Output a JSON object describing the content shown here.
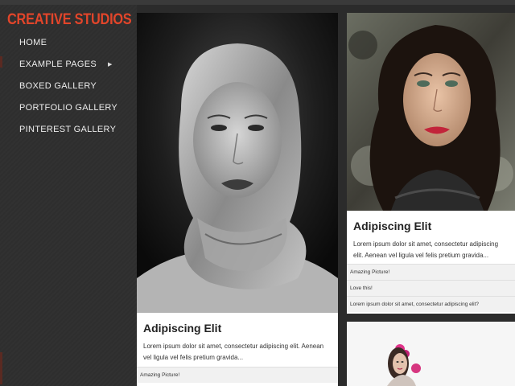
{
  "brand": {
    "logo_text": "CREATIVE STUDIOS",
    "accent_color": "#e2452a"
  },
  "nav": {
    "items": [
      {
        "label": "HOME"
      },
      {
        "label": "EXAMPLE PAGES",
        "has_submenu": true,
        "submenu_icon": "chevron-right-icon"
      },
      {
        "label": "BOXED GALLERY"
      },
      {
        "label": "PORTFOLIO GALLERY"
      },
      {
        "label": "PINTEREST GALLERY"
      }
    ]
  },
  "posts": [
    {
      "image": "woman-in-satin-headscarf-bw-photo",
      "title": "Adipiscing Elit",
      "text": "Lorem ipsum dolor sit amet, consectetur adipiscing elit. Aenean vel ligula vel felis pretium gravida...",
      "comments": [
        "Amazing Picture!"
      ]
    },
    {
      "image": "woman-with-curly-hair-artistic-photo",
      "title": "Adipiscing Elit",
      "text": "Lorem ipsum dolor sit amet, consectetur adipiscing elit. Aenean vel ligula vel felis pretium gravida...",
      "comments": [
        "Amazing Picture!",
        "Love this!",
        "Lorem ipsum dolor sit amet, consectetur adipiscing elit?"
      ]
    },
    {
      "image": "woman-with-pink-flowers-photo"
    }
  ]
}
